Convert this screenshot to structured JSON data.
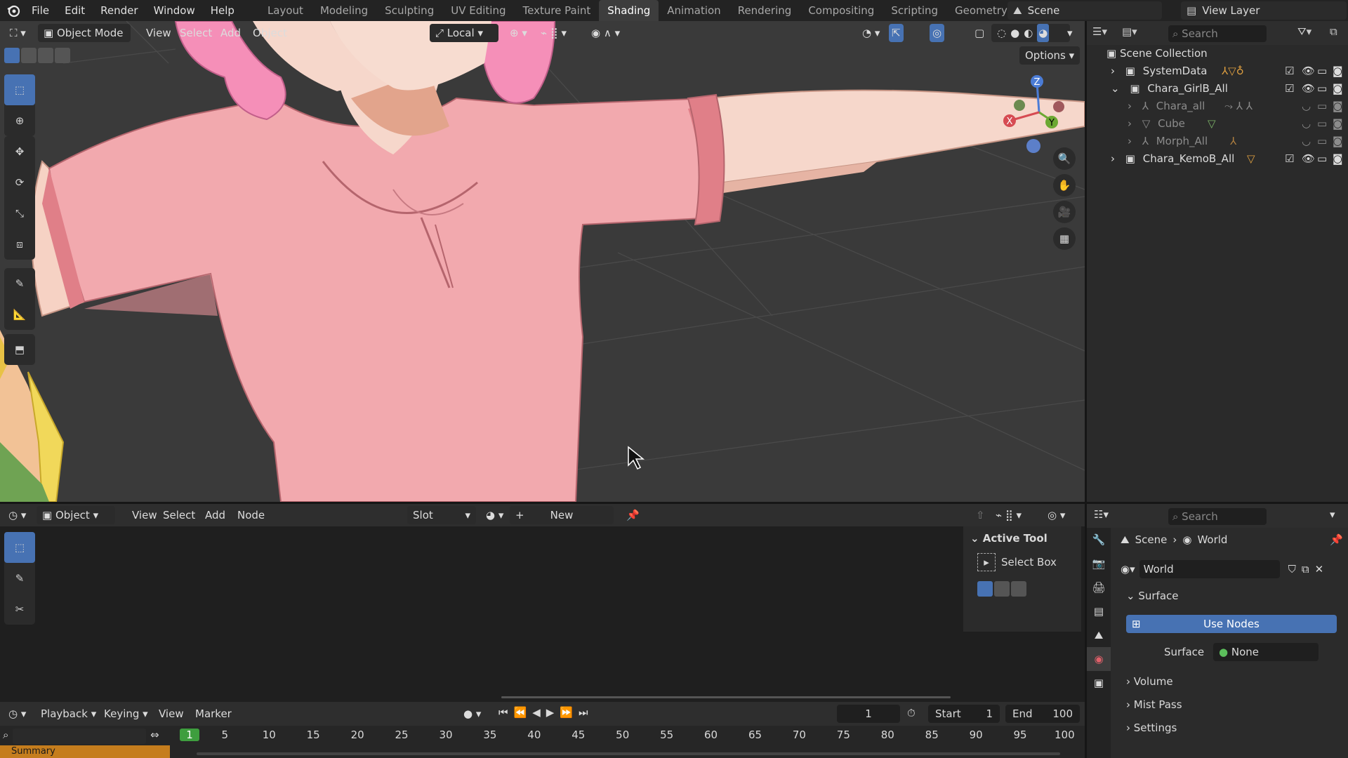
{
  "topbar": {
    "menus": [
      "File",
      "Edit",
      "Render",
      "Window",
      "Help"
    ],
    "workspaces": [
      "Layout",
      "Modeling",
      "Sculpting",
      "UV Editing",
      "Texture Paint",
      "Shading",
      "Animation",
      "Rendering",
      "Compositing",
      "Scripting",
      "Geometry Nodes"
    ],
    "active_workspace": "Shading",
    "scene": "Scene",
    "view_layer": "View Layer"
  },
  "viewport": {
    "mode": "Object Mode",
    "menus": [
      "View",
      "Select",
      "Add",
      "Object"
    ],
    "transform_orientation": "Local",
    "options_label": "Options",
    "gizmo": {
      "x": "X",
      "y": "Y",
      "z": "Z"
    }
  },
  "outliner": {
    "search_placeholder": "Search",
    "root": "Scene Collection",
    "rows": [
      {
        "label": "SystemData"
      },
      {
        "label": "Chara_GirlB_All"
      },
      {
        "label": "Chara_all"
      },
      {
        "label": "Cube"
      },
      {
        "label": "Morph_All"
      },
      {
        "label": "Chara_KemoB_All"
      }
    ]
  },
  "node_editor": {
    "type": "Object",
    "menus": [
      "View",
      "Select",
      "Add",
      "Node"
    ],
    "slot": "Slot",
    "new_label": "New",
    "sidebar": {
      "panel": "Active Tool",
      "tool": "Select Box"
    }
  },
  "properties": {
    "search_placeholder": "Search",
    "breadcrumb": [
      "Scene",
      "World"
    ],
    "world_name": "World",
    "surface_panel": "Surface",
    "use_nodes": "Use Nodes",
    "surface_label": "Surface",
    "surface_value": "None",
    "panels": [
      "Volume",
      "Mist Pass",
      "Settings"
    ]
  },
  "timeline": {
    "menus": [
      "Playback",
      "Keying",
      "View",
      "Marker"
    ],
    "current_frame": "1",
    "start_label": "Start",
    "start": "1",
    "end_label": "End",
    "end": "100",
    "ticks": [
      "1",
      "5",
      "10",
      "15",
      "20",
      "25",
      "30",
      "35",
      "40",
      "45",
      "50",
      "55",
      "60",
      "65",
      "70",
      "75",
      "80",
      "85",
      "90",
      "95",
      "100"
    ],
    "summary": "Summary"
  },
  "colors": {
    "accent": "#4772b3",
    "shirt": "#f2a9ae",
    "hair": "#f58fb8",
    "frame_marker": "#3e9e3e"
  }
}
